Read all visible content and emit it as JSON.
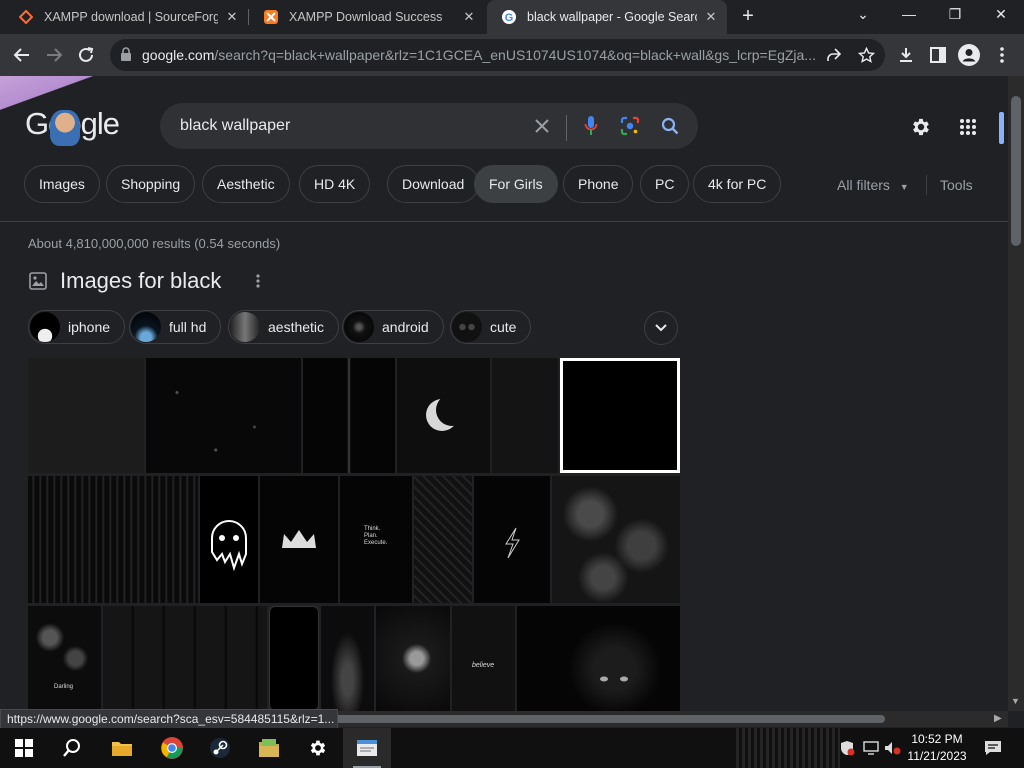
{
  "browser": {
    "tabs": [
      {
        "title": "XAMPP download | SourceForge.net",
        "icon": "xampp-sourceforge-icon",
        "active": false
      },
      {
        "title": "XAMPP Download Success",
        "icon": "xampp-icon",
        "active": false
      },
      {
        "title": "black wallpaper - Google Search",
        "icon": "google-icon",
        "active": true
      }
    ],
    "url_host": "google.com",
    "url_rest": "/search?q=black+wallpaper&rlz=1C1GCEA_enUS1074US1074&oq=black+wall&gs_lcrp=EgZja..."
  },
  "search": {
    "logo": "Google",
    "query": "black wallpaper",
    "chips": [
      "Images",
      "Shopping",
      "Aesthetic",
      "HD 4K",
      "Download",
      "For Girls",
      "Phone",
      "PC",
      "4k for PC"
    ],
    "all_filters": "All filters",
    "tools": "Tools",
    "stats": "About 4,810,000,000 results (0.54 seconds)"
  },
  "images": {
    "title": "Images for black",
    "subchips": [
      "iphone",
      "full hd",
      "aesthetic",
      "android",
      "cute"
    ],
    "tile_text": {
      "think": "Think.\nPlan.\nExecute.",
      "believe": "believe",
      "darling": "Darling"
    }
  },
  "status_url": "https://www.google.com/search?sca_esv=584485115&rlz=1...",
  "clock": {
    "time": "10:52 PM",
    "date": "11/21/2023"
  },
  "colors": {
    "accent": "#8ab4f8",
    "bg": "#202124",
    "chip_border": "#3c4043"
  }
}
